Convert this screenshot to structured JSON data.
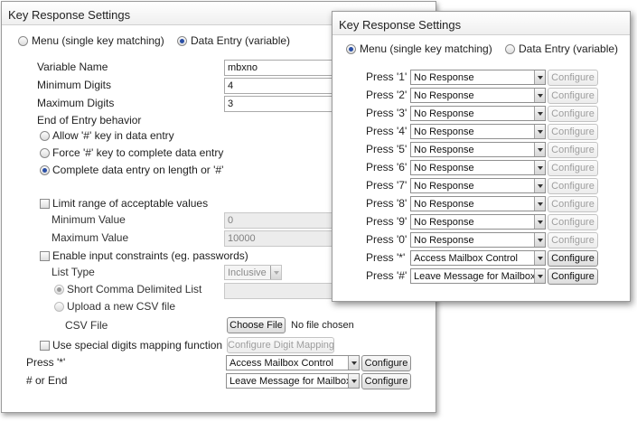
{
  "back_panel": {
    "title": "Key Response Settings",
    "mode_menu": "Menu (single key matching)",
    "mode_data_entry": "Data Entry (variable)",
    "variable_name_label": "Variable Name",
    "variable_name_value": "mbxno",
    "min_digits_label": "Minimum Digits",
    "min_digits_value": "4",
    "max_digits_label": "Maximum Digits",
    "max_digits_value": "3",
    "end_of_entry_label": "End of Entry behavior",
    "allow_hash": "Allow '#' key in data entry",
    "force_hash": "Force '#' key to complete data entry",
    "complete_on_length": "Complete data entry on length or '#'",
    "limit_range_label": "Limit range of acceptable values",
    "min_value_label": "Minimum Value",
    "min_value_value": "0",
    "max_value_label": "Maximum Value",
    "max_value_value": "10000",
    "input_constraints_label": "Enable input constraints (eg. passwords)",
    "list_type_label": "List Type",
    "list_type_value": "Inclusive",
    "short_list_label": "Short Comma Delimited List",
    "upload_csv_label": "Upload a new CSV file",
    "csv_file_label": "CSV File",
    "choose_file_button": "Choose File",
    "no_file_text": "No file chosen",
    "digit_mapping_label": "Use special digits mapping function",
    "configure_digit_mapping_button": "Configure Digit Mapping",
    "press_star_label": "Press '*'",
    "press_star_value": "Access Mailbox Control",
    "hash_or_end_label": "# or End",
    "hash_or_end_value": "Leave Message for Mailbox...",
    "configure_label": "Configure"
  },
  "front_panel": {
    "title": "Key Response Settings",
    "mode_menu": "Menu (single key matching)",
    "mode_data_entry": "Data Entry (variable)",
    "configure_label": "Configure",
    "rows": [
      {
        "label": "Press '1'",
        "value": "No Response",
        "configure_enabled": false
      },
      {
        "label": "Press '2'",
        "value": "No Response",
        "configure_enabled": false
      },
      {
        "label": "Press '3'",
        "value": "No Response",
        "configure_enabled": false
      },
      {
        "label": "Press '4'",
        "value": "No Response",
        "configure_enabled": false
      },
      {
        "label": "Press '5'",
        "value": "No Response",
        "configure_enabled": false
      },
      {
        "label": "Press '6'",
        "value": "No Response",
        "configure_enabled": false
      },
      {
        "label": "Press '7'",
        "value": "No Response",
        "configure_enabled": false
      },
      {
        "label": "Press '8'",
        "value": "No Response",
        "configure_enabled": false
      },
      {
        "label": "Press '9'",
        "value": "No Response",
        "configure_enabled": false
      },
      {
        "label": "Press '0'",
        "value": "No Response",
        "configure_enabled": false
      },
      {
        "label": "Press '*'",
        "value": "Access Mailbox Control",
        "configure_enabled": true
      },
      {
        "label": "Press '#'",
        "value": "Leave Message for Mailbox...",
        "configure_enabled": true
      }
    ]
  }
}
